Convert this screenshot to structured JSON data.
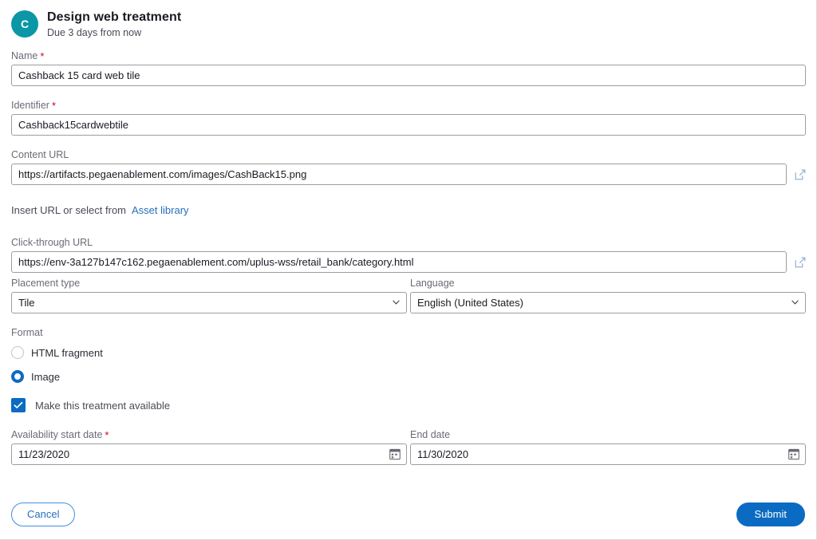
{
  "header": {
    "avatar_initial": "C",
    "title": "Design web treatment",
    "subtitle": "Due 3 days from now"
  },
  "form": {
    "name": {
      "label": "Name",
      "required_mark": "*",
      "value": "Cashback 15 card web tile"
    },
    "identifier": {
      "label": "Identifier",
      "required_mark": "*",
      "value": "Cashback15cardwebtile"
    },
    "content_url": {
      "label": "Content URL",
      "value": "https://artifacts.pegaenablement.com/images/CashBack15.png"
    },
    "helper": {
      "text": "Insert URL or select from",
      "link_label": "Asset library"
    },
    "click_through_url": {
      "label": "Click-through URL",
      "value": "https://env-3a127b147c162.pegaenablement.com/uplus-wss/retail_bank/category.html"
    },
    "placement_type": {
      "label": "Placement type",
      "value": "Tile",
      "options": [
        "Tile"
      ]
    },
    "language": {
      "label": "Language",
      "value": "English (United States)",
      "options": [
        "English (United States)"
      ]
    },
    "format": {
      "label": "Format",
      "options": [
        {
          "label": "HTML fragment",
          "selected": false
        },
        {
          "label": "Image",
          "selected": true
        }
      ]
    },
    "availability_checkbox": {
      "label": "Make this treatment available",
      "checked": true
    },
    "start_date": {
      "label": "Availability start date",
      "required_mark": "*",
      "value": "11/23/2020"
    },
    "end_date": {
      "label": "End date",
      "value": "11/30/2020"
    }
  },
  "footer": {
    "cancel_label": "Cancel",
    "submit_label": "Submit"
  },
  "colors": {
    "avatar_teal": "#0b97a5",
    "accent_blue": "#0b6bc2",
    "link_blue": "#276fb9",
    "required_red": "#d6001c"
  }
}
